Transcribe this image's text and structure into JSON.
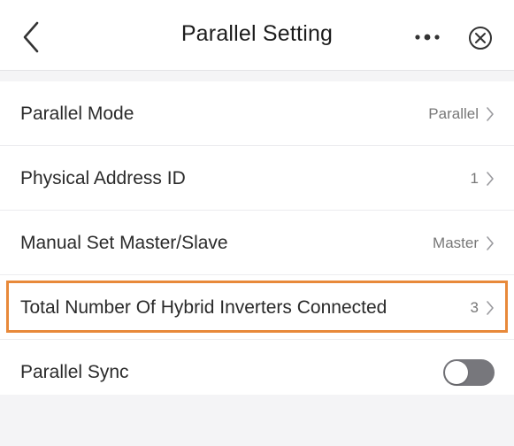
{
  "header": {
    "title": "Parallel Setting"
  },
  "icons": {
    "back": "chevron-left-icon",
    "more": "more-dots-icon",
    "close": "close-circle-icon",
    "row_arrow": "chevron-right-icon"
  },
  "rows": [
    {
      "label": "Parallel Mode",
      "value": "Parallel"
    },
    {
      "label": "Physical Address ID",
      "value": "1"
    },
    {
      "label": "Manual Set Master/Slave",
      "value": "Master"
    },
    {
      "label": "Total Number Of Hybrid Inverters Connected",
      "value": "3"
    },
    {
      "label": "Parallel Sync",
      "toggle_on": false
    }
  ],
  "colors": {
    "highlight": "#e8893a",
    "toggle_off": "#77777c",
    "background": "#f4f4f6"
  }
}
